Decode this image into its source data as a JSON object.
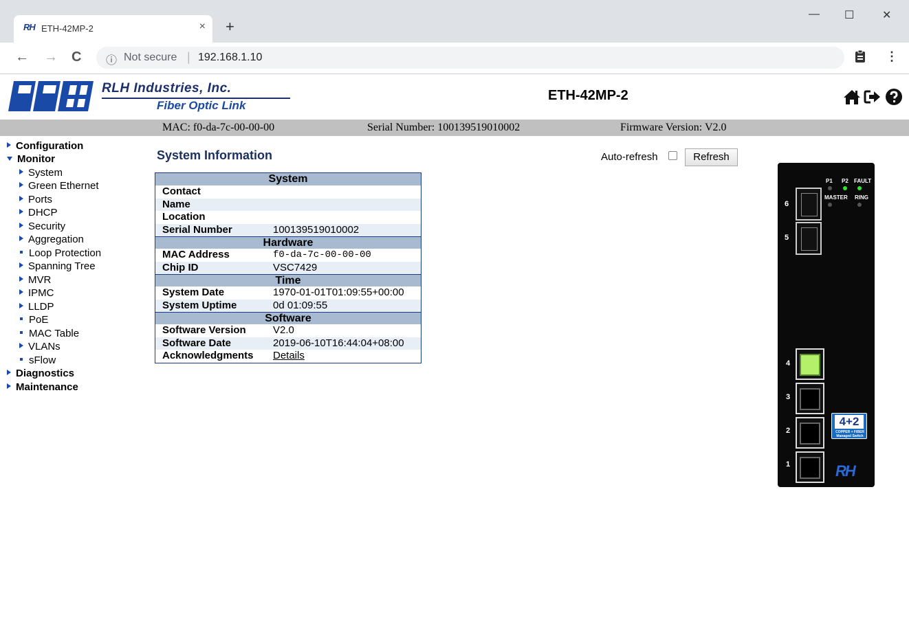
{
  "browser": {
    "tab_favicon": "RH",
    "tab_title": "ETH-42MP-2",
    "tab_close": "×",
    "new_tab": "+",
    "window_min": "—",
    "window_max": "☐",
    "window_close": "✕",
    "nav_back": "←",
    "nav_forward": "→",
    "nav_reload": "C",
    "security_icon": "ⓘ",
    "security_text": "Not secure",
    "separator": "|",
    "url": "192.168.1.10",
    "extension_icon": "clipboard-icon",
    "menu_icon": "⋮"
  },
  "header": {
    "brand_name": "RLH Industries, Inc.",
    "brand_sub": "Fiber Optic Link",
    "product_title": "ETH-42MP-2",
    "icons": [
      "home-icon",
      "logout-icon",
      "help-icon"
    ]
  },
  "infobar": {
    "mac": "MAC: f0-da-7c-00-00-00",
    "serial": "Serial Number: 100139519010002",
    "firmware": "Firmware Version: V2.0"
  },
  "menu": {
    "configuration": "Configuration",
    "monitor": "Monitor",
    "monitor_items": [
      "System",
      "Green Ethernet",
      "Ports",
      "DHCP",
      "Security",
      "Aggregation",
      "Loop Protection",
      "Spanning Tree",
      "MVR",
      "IPMC",
      "LLDP",
      "PoE",
      "MAC Table",
      "VLANs",
      "sFlow"
    ],
    "diagnostics": "Diagnostics",
    "maintenance": "Maintenance"
  },
  "main": {
    "title": "System Information",
    "auto_refresh_label": "Auto-refresh",
    "refresh_button": "Refresh"
  },
  "sysinfo": {
    "system": {
      "header": "System",
      "rows": [
        {
          "key": "Contact",
          "value": ""
        },
        {
          "key": "Name",
          "value": ""
        },
        {
          "key": "Location",
          "value": ""
        },
        {
          "key": "Serial Number",
          "value": "100139519010002"
        }
      ]
    },
    "hardware": {
      "header": "Hardware",
      "rows": [
        {
          "key": "MAC Address",
          "value": "f0-da-7c-00-00-00"
        },
        {
          "key": "Chip ID",
          "value": "VSC7429"
        }
      ]
    },
    "time": {
      "header": "Time",
      "rows": [
        {
          "key": "System Date",
          "value": "1970-01-01T01:09:55+00:00"
        },
        {
          "key": "System Uptime",
          "value": "0d 01:09:55"
        }
      ]
    },
    "software": {
      "header": "Software",
      "rows": [
        {
          "key": "Software Version",
          "value": "V2.0"
        },
        {
          "key": "Software Date",
          "value": "2019-06-10T16:44:04+08:00"
        },
        {
          "key": "Acknowledgments",
          "value": "Details"
        }
      ]
    }
  },
  "device": {
    "led_labels": {
      "p1": "P1",
      "p2": "P2",
      "fault": "FAULT",
      "master": "MASTER",
      "ring": "RING"
    },
    "led_colors": {
      "off": "#555555",
      "green": "#2ee82e"
    },
    "ports": [
      "6",
      "5",
      "4",
      "3",
      "2",
      "1"
    ],
    "badge_number": "4+2",
    "badge_text": "COPPER + FIBER Managed Switch",
    "logo": "RH"
  }
}
